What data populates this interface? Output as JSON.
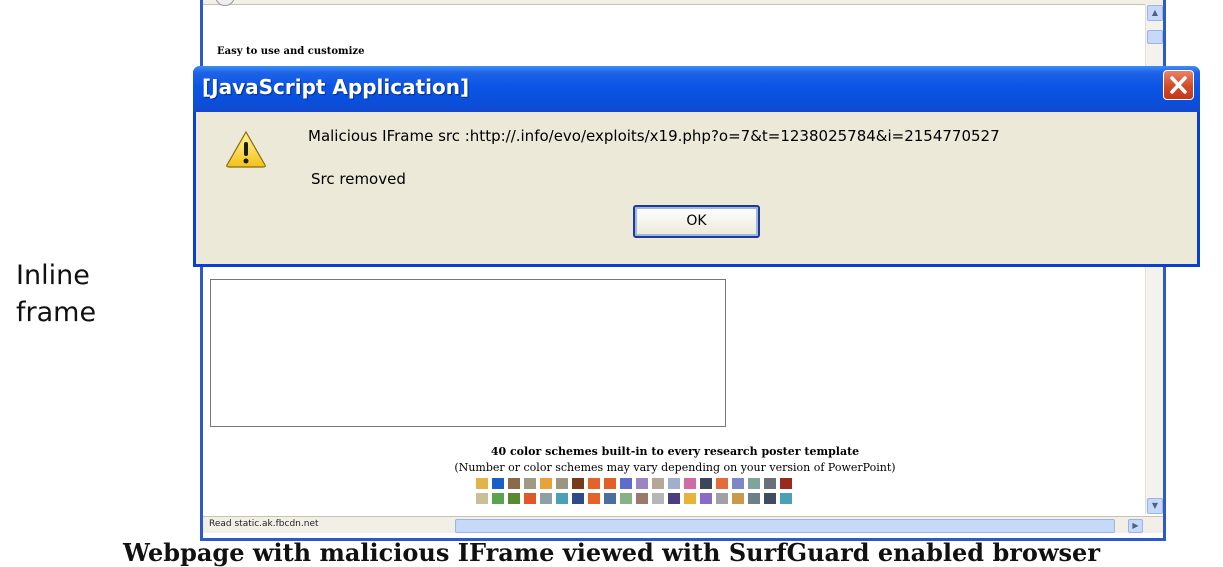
{
  "side_label": [
    "Inline",
    "frame"
  ],
  "page": {
    "content_heading": "Easy to use and customize",
    "scheme_title": "40 color schemes built-in to every research poster template",
    "scheme_subtitle": "(Number or color schemes may vary depending on your version of PowerPoint)",
    "swatch_rows": [
      [
        "#e3b24b",
        "#1a5fc6",
        "#8a6a4a",
        "#a09a82",
        "#e8a23c",
        "#9b9582",
        "#7a3a1a",
        "#e6622b",
        "#e35f2a",
        "#5e6ccb",
        "#9b86c2",
        "#b6a898",
        "#a3aec9",
        "#d16ba6",
        "#3d4656",
        "#e46b3c",
        "#7e86c9",
        "#7ea49c",
        "#6a707a",
        "#9a2a1e"
      ],
      [
        "#c8bf9b",
        "#5aa44d",
        "#5a8a2e",
        "#e2572a",
        "#8ca0a6",
        "#4aa0b5",
        "#2e4a8a",
        "#e6622b",
        "#4a6e9e",
        "#86b286",
        "#9a7a6a",
        "#b6b6b6",
        "#4a3e7e",
        "#e8b23c",
        "#8a6ac8",
        "#a0a0a6",
        "#c89a4a",
        "#6e7e8a",
        "#3e4e5e",
        "#4aa0b5"
      ]
    ],
    "status_text": "Read static.ak.fbcdn.net"
  },
  "dialog": {
    "title": "[JavaScript Application]",
    "message": "Malicious IFrame src :http://.info/evo/exploits/x19.php?o=7&t=1238025784&i=2154770527",
    "message2": "Src removed",
    "ok_label": "OK"
  },
  "caption": "Webpage with malicious IFrame viewed with SurfGuard enabled browser"
}
